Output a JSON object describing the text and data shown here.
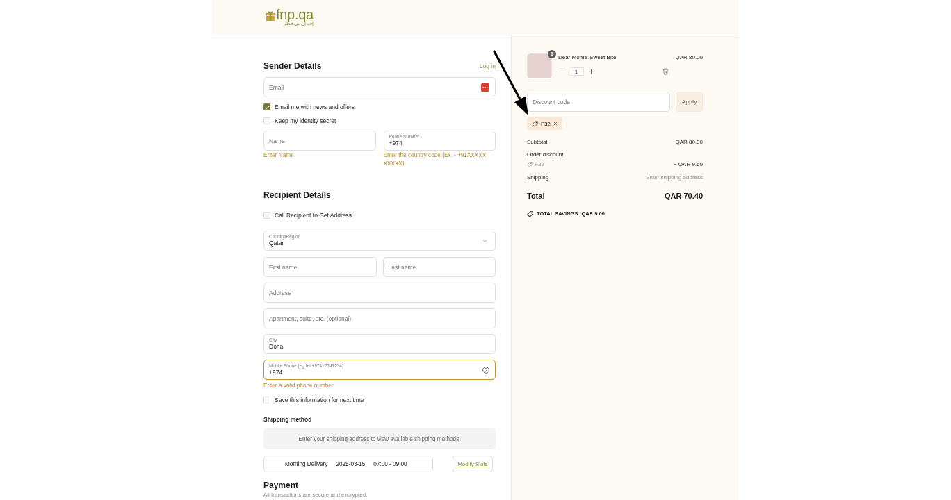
{
  "header": {
    "logo": {
      "name": "fnp.qa",
      "tagline": "إف إن بي قطر"
    }
  },
  "sender": {
    "title": "Sender Details",
    "login_link": "Log in",
    "email": {
      "placeholder": "Email"
    },
    "options": [
      {
        "label": "Email me with news and offers",
        "checked": true
      },
      {
        "label": "Keep my identity secret",
        "checked": false
      }
    ],
    "name": {
      "placeholder": "Name",
      "error": "Enter Name"
    },
    "phone": {
      "label": "Phone Number",
      "value": "+974",
      "error": "Enter the country code (Ex. - +91XXXXX XXXXX)"
    }
  },
  "recipient": {
    "title": "Recipient Details",
    "call_option": {
      "label": "Call Recipient to Get Address",
      "checked": false
    },
    "country": {
      "label": "Country/Region",
      "value": "Qatar"
    },
    "first_name": {
      "placeholder": "First name"
    },
    "last_name": {
      "placeholder": "Last name"
    },
    "address": {
      "placeholder": "Address"
    },
    "apartment": {
      "placeholder": "Apartment, suite, etc. (optional)"
    },
    "city": {
      "label": "City",
      "value": "Doha"
    },
    "mobile": {
      "label": "Mobile Phone (eg tel:+97412341234)",
      "value": "+974",
      "focused": true,
      "error": "Enter a valid phone number"
    },
    "save_option": {
      "label": "Save this information for next time",
      "checked": false
    }
  },
  "shipping": {
    "title": "Shipping method",
    "notice": "Enter your shipping address to view available shipping methods.",
    "slot": {
      "type": "Morning Delivery",
      "date": "2025-03-15",
      "time": "07:00 - 09:00"
    },
    "modify_button": "Modify Slots"
  },
  "payment": {
    "title": "Payment",
    "note": "All transactions are secure and encrypted."
  },
  "cart": {
    "items": [
      {
        "name": "Dear Mom's Sweet Bite",
        "price": "QAR 80.00",
        "badge": "1",
        "quantity": "1"
      }
    ],
    "discount": {
      "placeholder": "Discount code",
      "button": {
        "label": "Apply",
        "disabled": true
      },
      "applied": [
        {
          "code": "F32"
        }
      ]
    },
    "summary": {
      "subtotal": {
        "label": "Subtotal",
        "value": "QAR 80.00"
      },
      "discount": {
        "label": "Order discount",
        "code": "F32",
        "value": "− QAR 9.60"
      },
      "shipping": {
        "label": "Shipping",
        "value": "Enter shipping address"
      },
      "total": {
        "label": "Total",
        "value": "QAR 70.40"
      },
      "savings": {
        "label": "TOTAL SAVINGS",
        "value": "QAR 9.60"
      }
    }
  }
}
